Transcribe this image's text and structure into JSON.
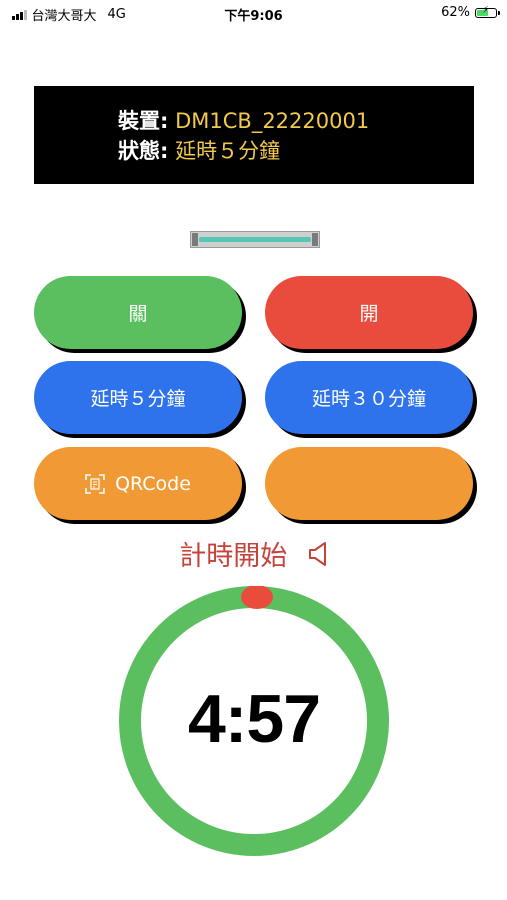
{
  "status_bar": {
    "carrier": "台灣大哥大",
    "network": "4G",
    "time": "下午9:06",
    "battery_percent": "62%",
    "battery_level": 0.62
  },
  "info": {
    "device_label": "裝置:",
    "device_value": "DM1CB_22220001",
    "state_label": "狀態:",
    "state_value": "延時５分鐘"
  },
  "buttons": {
    "off_label": "關",
    "on_label": "開",
    "delay5_label": "延時５分鐘",
    "delay30_label": "延時３０分鐘",
    "qrcode_label": "QRCode",
    "blank_label": ""
  },
  "timer": {
    "status_text": "計時開始",
    "countdown": "4:57",
    "ring_color": "#5bbf60",
    "marker_color": "#e94c3d"
  },
  "icons": {
    "speaker": "speaker-icon",
    "qr": "qr-scan-icon"
  }
}
